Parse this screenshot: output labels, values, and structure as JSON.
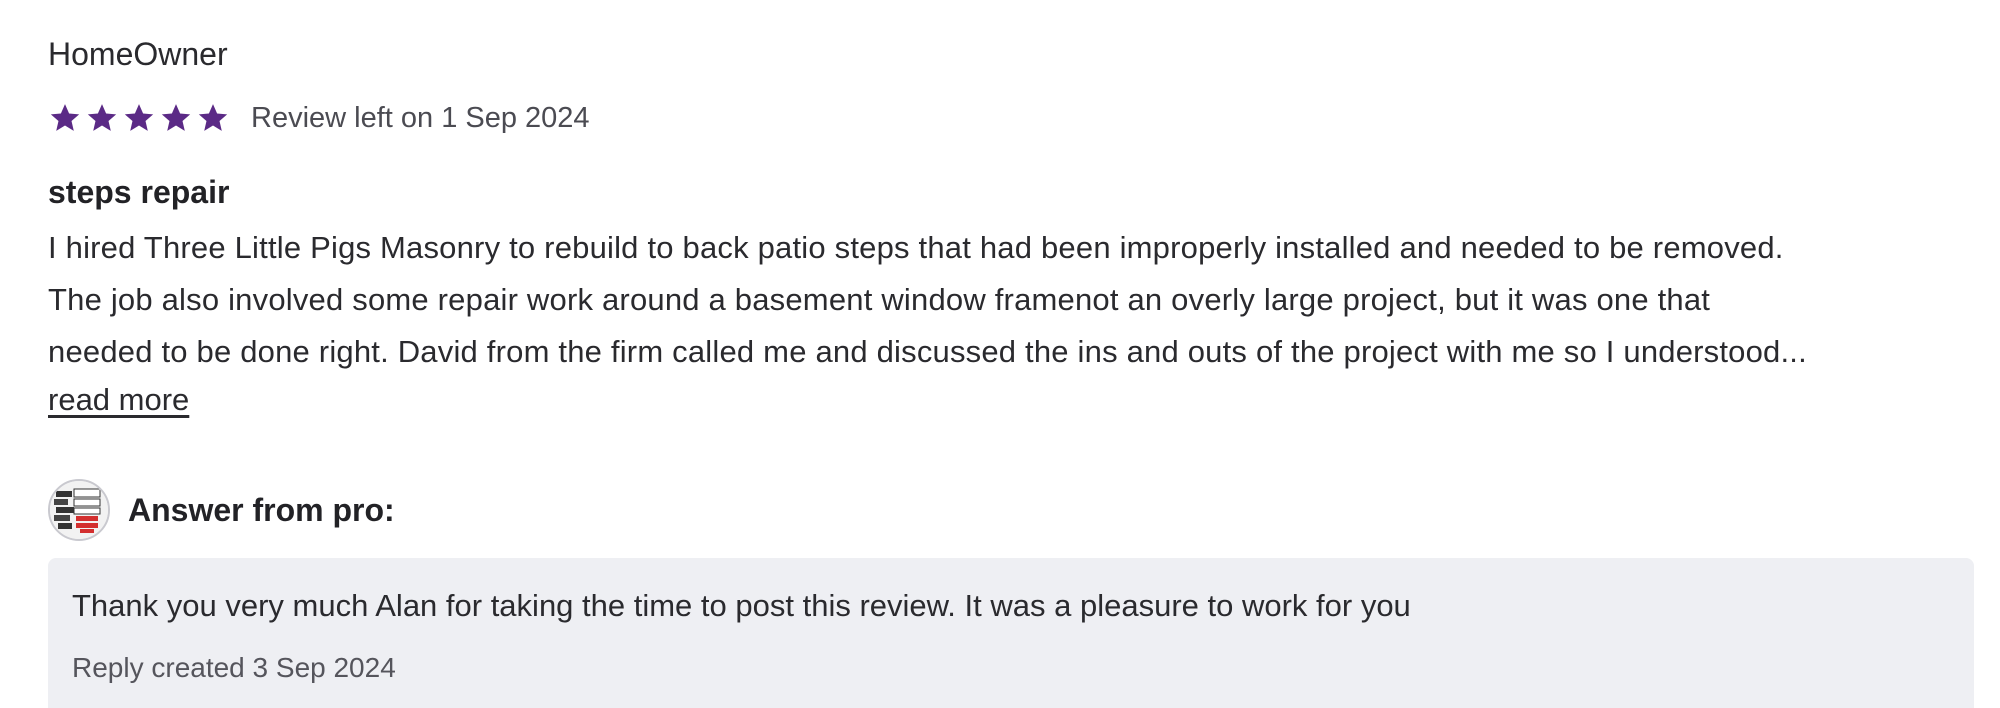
{
  "reviewer": {
    "name": "HomeOwner"
  },
  "rating": {
    "value": 5,
    "max": 5,
    "star_color": "#5b2a86",
    "date_text": "Review left on 1 Sep 2024"
  },
  "review": {
    "title": "steps repair",
    "body_lines": [
      "I hired Three Little Pigs Masonry to rebuild to back patio steps that had been improperly installed and needed to be removed.",
      "The job also involved some repair work around a basement window framenot an overly large project, but it was one that",
      "needed to be done right. David from the firm called me and discussed the ins and outs of the project with me so I understood..."
    ],
    "read_more_label": "read more"
  },
  "answer": {
    "label": "Answer from pro:",
    "avatar_icon": "pro-logo-avatar",
    "reply_text": "Thank you very much Alan for taking the time to post this review. It was a pleasure to work for you",
    "reply_date": "Reply created 3 Sep 2024",
    "background": "#eeeff3"
  }
}
